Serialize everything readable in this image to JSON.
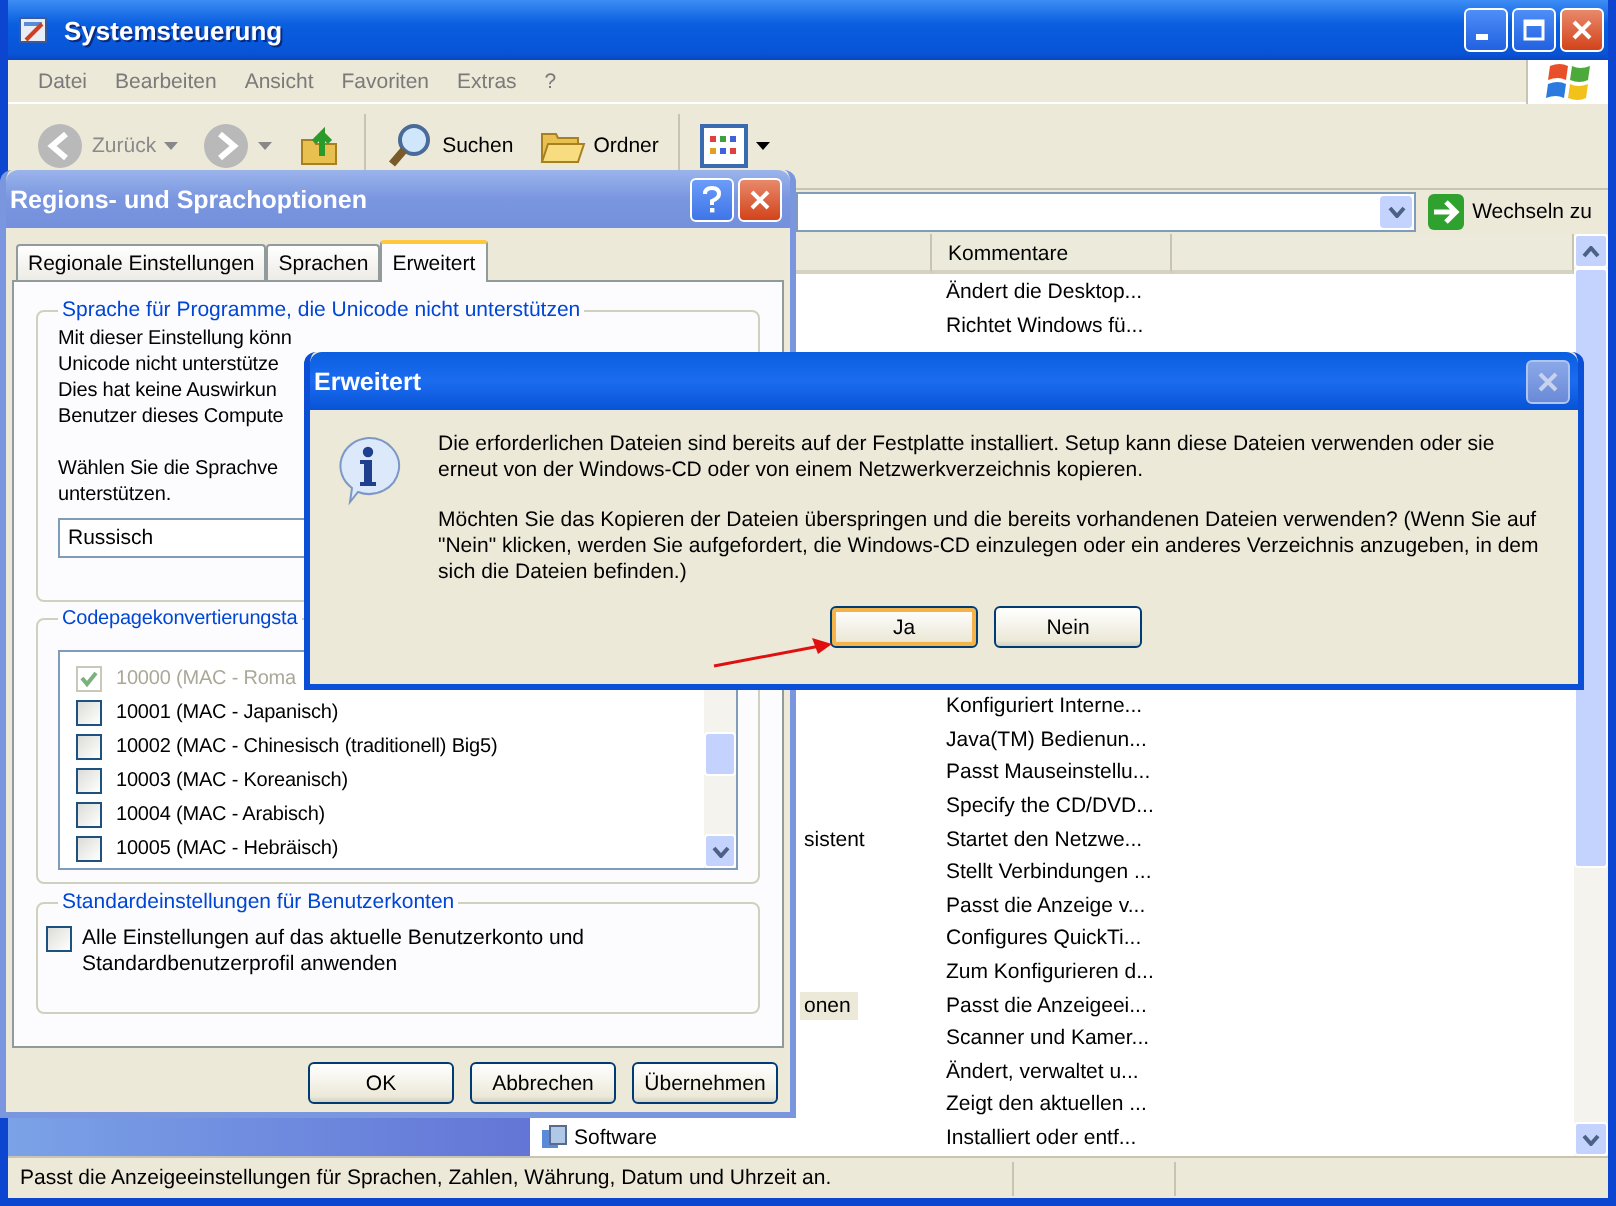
{
  "main_window": {
    "title": "Systemsteuerung",
    "menu": [
      "Datei",
      "Bearbeiten",
      "Ansicht",
      "Favoriten",
      "Extras",
      "?"
    ],
    "toolbar": [
      {
        "kind": "back",
        "label": "Zurück",
        "disabled": true
      },
      {
        "kind": "forward",
        "disabled": true
      },
      {
        "kind": "up",
        "disabled": false
      },
      {
        "kind": "search",
        "label": "Suchen",
        "disabled": false
      },
      {
        "kind": "folders",
        "label": "Ordner",
        "disabled": false
      },
      {
        "kind": "views",
        "disabled": false
      }
    ],
    "go_button": "Wechseln zu",
    "column": "Kommentare",
    "rows_top": [
      {
        "comment": "Ändert die Desktop...",
        "selected": false
      },
      {
        "comment": "Richtet Windows fü...",
        "selected": false
      }
    ],
    "rows_bottom": [
      {
        "comment": "Konfiguriert Interne...",
        "selected": false
      },
      {
        "comment": "Java(TM) Bedienun...",
        "selected": false
      },
      {
        "comment": "Passt Mauseinstellu...",
        "selected": false
      },
      {
        "comment": "Specify the CD/DVD...",
        "selected": false
      },
      {
        "name": "sistent",
        "icon": false,
        "comment": "Startet den Netzwe...",
        "selected": false
      },
      {
        "comment": "Stellt Verbindungen ...",
        "selected": false
      },
      {
        "comment": "Passt die Anzeige v...",
        "selected": false
      },
      {
        "comment": "Configures QuickTi...",
        "selected": false
      },
      {
        "comment": "Zum Konfigurieren d...",
        "selected": false
      },
      {
        "name": "onen",
        "icon": false,
        "comment": "Passt die Anzeigeei...",
        "selected": true
      },
      {
        "comment": "Scanner und Kamer...",
        "selected": false
      },
      {
        "comment": "Ändert, verwaltet u...",
        "selected": false
      },
      {
        "comment": "Zeigt den aktuellen ...",
        "selected": false
      },
      {
        "name": "Software",
        "icon": true,
        "comment": "Installiert oder entf...",
        "selected": false
      }
    ],
    "status": "Passt die Anzeigeeinstellungen für Sprachen, Zahlen, Währung, Datum und Uhrzeit an."
  },
  "regions_dialog": {
    "title": "Regions- und Sprachoptionen",
    "tabs": [
      {
        "label": "Regionale Einstellungen",
        "selected": false
      },
      {
        "label": "Sprachen",
        "selected": false
      },
      {
        "label": "Erweitert",
        "selected": true
      }
    ],
    "unicode_group": {
      "title": "Sprache für Programme, die Unicode nicht unterstützen",
      "description_lines": [
        "Mit dieser Einstellung könn",
        "Unicode nicht unterstütze",
        "Dies hat keine Auswirkun",
        "Benutzer dieses Compute"
      ],
      "prompt_lines": [
        "Wählen Sie die Sprachve",
        "unterstützen."
      ],
      "language": "Russisch"
    },
    "codepage_group": {
      "title": "Codepagekonvertierungsta",
      "items": [
        {
          "label": "10000 (MAC - Roma",
          "checked": true,
          "disabled": true
        },
        {
          "label": "10001 (MAC - Japanisch)",
          "checked": false,
          "disabled": false
        },
        {
          "label": "10002 (MAC - Chinesisch (traditionell) Big5)",
          "checked": false,
          "disabled": false
        },
        {
          "label": "10003 (MAC - Koreanisch)",
          "checked": false,
          "disabled": false
        },
        {
          "label": "10004 (MAC - Arabisch)",
          "checked": false,
          "disabled": false
        },
        {
          "label": "10005 (MAC - Hebräisch)",
          "checked": false,
          "disabled": false
        }
      ]
    },
    "accounts_group": {
      "title": "Standardeinstellungen für Benutzerkonten",
      "option": {
        "label": "Alle Einstellungen auf das aktuelle Benutzerkonto und Standardbenutzerprofil anwenden",
        "checked": false
      }
    },
    "buttons": [
      "OK",
      "Abbrechen",
      "Übernehmen"
    ]
  },
  "message_dialog": {
    "title": "Erweitert",
    "close_disabled": true,
    "paragraphs": [
      "Die erforderlichen Dateien sind bereits auf der Festplatte installiert. Setup kann diese Dateien verwenden oder sie erneut von der Windows-CD oder von einem Netzwerkverzeichnis kopieren.",
      "Möchten Sie das Kopieren der Dateien überspringen und die bereits vorhandenen Dateien verwenden? (Wenn Sie auf \"Nein\" klicken, werden Sie aufgefordert, die Windows-CD einzulegen oder ein anderes Verzeichnis anzugeben, in dem sich die Dateien befinden.)"
    ],
    "buttons": [
      {
        "label": "Ja",
        "default": true
      },
      {
        "label": "Nein",
        "default": false
      }
    ]
  }
}
